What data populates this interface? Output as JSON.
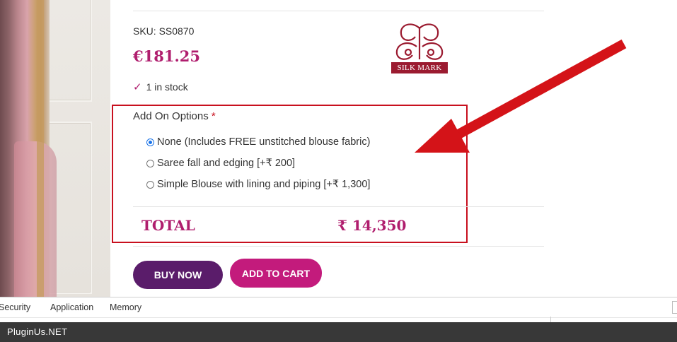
{
  "product": {
    "sku_label": "SKU: SS0870",
    "price": "€181.25",
    "stock": "1 in stock",
    "silk_mark": "SILK MARK"
  },
  "addons": {
    "title": "Add On Options",
    "required_mark": "*",
    "options": [
      {
        "label": "None (Includes FREE unstitched blouse fabric)",
        "selected": true
      },
      {
        "label": "Saree fall and edging [+₹ 200]",
        "selected": false
      },
      {
        "label": "Simple Blouse with lining and piping [+₹ 1,300]",
        "selected": false
      }
    ]
  },
  "total": {
    "label": "TOTAL",
    "value": "₹ 14,350"
  },
  "buttons": {
    "buy_now": "BUY NOW",
    "add_to_cart": "ADD TO CART"
  },
  "devtools": {
    "tabs": [
      "Security",
      "Application",
      "Memory"
    ]
  },
  "footer": {
    "brand": "PluginUs.NET"
  },
  "colors": {
    "accent": "#b01e6e",
    "buy_now_bg": "#5a1c6a",
    "cart_bg": "#c31b7c",
    "highlight_red": "#c8101e"
  }
}
